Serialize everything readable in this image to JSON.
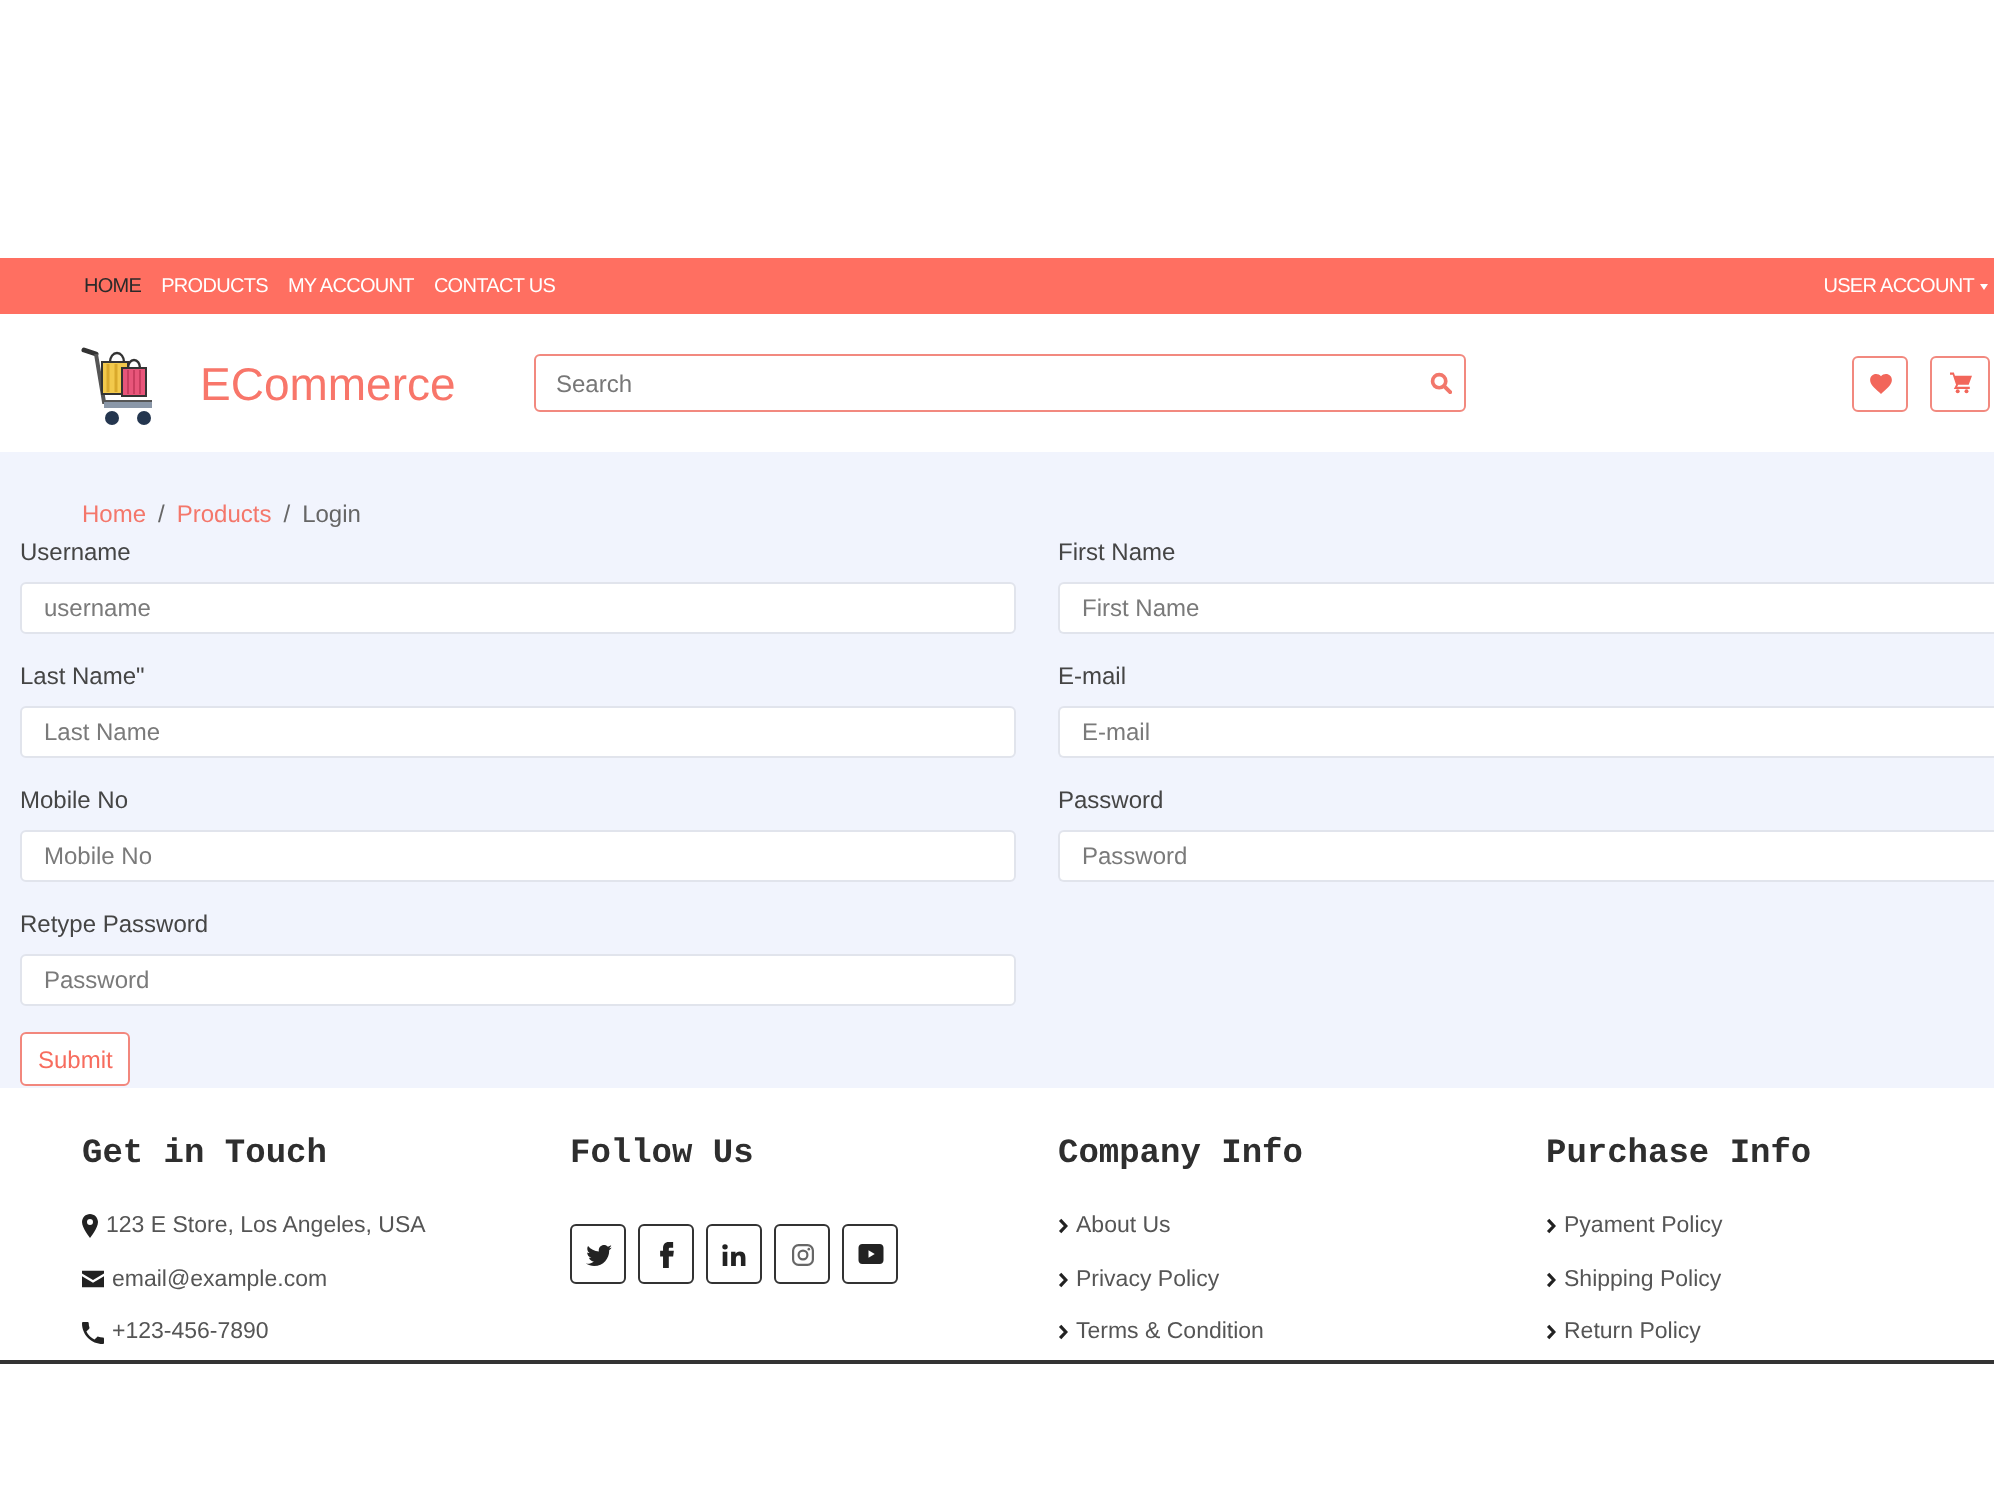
{
  "nav": {
    "links": [
      {
        "label": "HOME",
        "selected": true
      },
      {
        "label": "PRODUCTS",
        "selected": false
      },
      {
        "label": "MY ACCOUNT",
        "selected": false
      },
      {
        "label": "CONTACT US",
        "selected": false
      }
    ],
    "account": "USER ACCOUNT"
  },
  "header": {
    "brand": "ECommerce",
    "search": {
      "placeholder": "Search"
    }
  },
  "breadcrumb": [
    {
      "label": "Home",
      "kind": "link"
    },
    {
      "label": "/",
      "kind": "separator"
    },
    {
      "label": "Products",
      "kind": "link"
    },
    {
      "label": "/",
      "kind": "separator"
    },
    {
      "label": "Login",
      "kind": "current"
    }
  ],
  "form": {
    "fields": [
      {
        "label": "Username",
        "placeholder": "username"
      },
      {
        "label": "First Name",
        "placeholder": "First Name"
      },
      {
        "label": "Last Name\"",
        "placeholder": "Last Name"
      },
      {
        "label": "E-mail",
        "placeholder": "E-mail"
      },
      {
        "label": "Mobile No",
        "placeholder": "Mobile No"
      },
      {
        "label": "Password",
        "placeholder": "Password"
      },
      {
        "label": "Retype Password",
        "placeholder": "Password"
      }
    ],
    "submit": "Submit"
  },
  "footer": {
    "columns": [
      {
        "title": "Get in Touch",
        "kind": "contact",
        "items": [
          {
            "kind": "address",
            "text": "123 E Store, Los Angeles, USA"
          },
          {
            "kind": "email",
            "text": "email@example.com"
          },
          {
            "kind": "phone",
            "text": "+123-456-7890"
          }
        ]
      },
      {
        "title": "Follow Us",
        "kind": "social"
      },
      {
        "title": "Company Info",
        "kind": "links",
        "links": [
          "About Us",
          "Privacy Policy",
          "Terms & Condition"
        ]
      },
      {
        "title": "Purchase Info",
        "kind": "links",
        "links": [
          "Pyament Policy",
          "Shipping Policy",
          "Return Policy"
        ]
      }
    ]
  }
}
